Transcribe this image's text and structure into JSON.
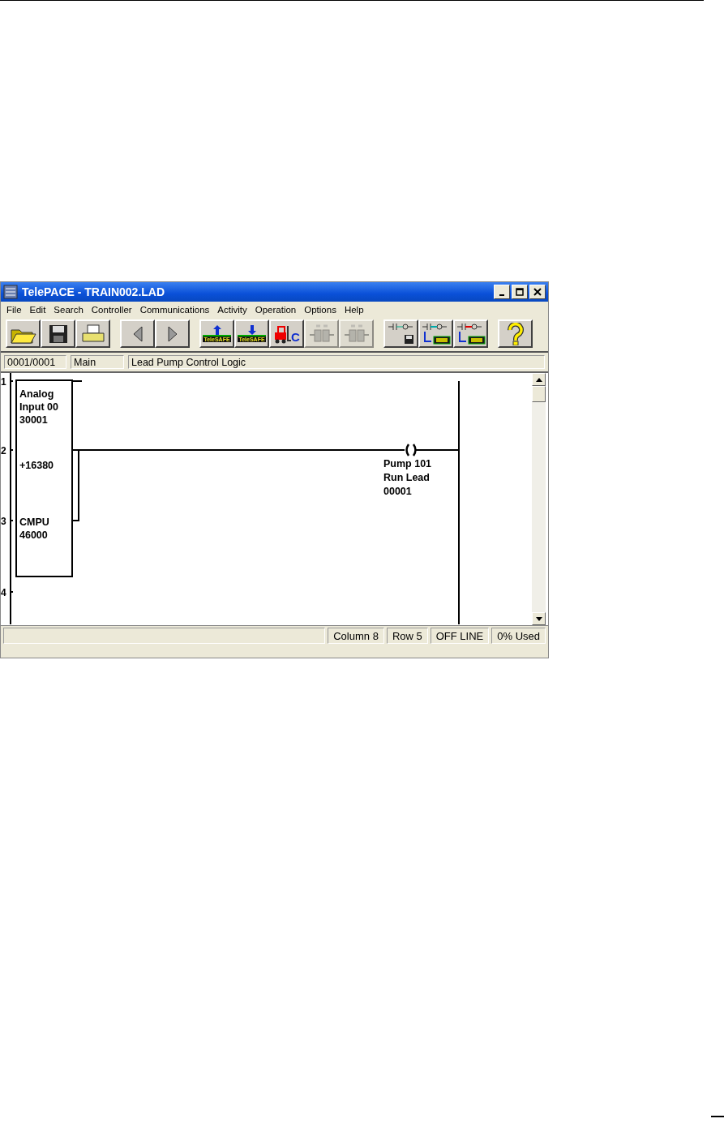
{
  "window": {
    "title": "TelePACE - TRAIN002.LAD"
  },
  "menu": [
    "File",
    "Edit",
    "Search",
    "Controller",
    "Communications",
    "Activity",
    "Operation",
    "Options",
    "Help"
  ],
  "toolbar": [
    [
      {
        "kind": "open",
        "disabled": false
      },
      {
        "kind": "save",
        "disabled": false
      },
      {
        "kind": "print",
        "disabled": false
      }
    ],
    [
      {
        "kind": "back",
        "disabled": false
      },
      {
        "kind": "forward",
        "disabled": false
      }
    ],
    [
      {
        "kind": "upload",
        "label": "TeleSAFE",
        "disabled": false
      },
      {
        "kind": "download",
        "label": "TeleSAFE",
        "disabled": false
      },
      {
        "kind": "forklift",
        "label": "C",
        "disabled": false
      },
      {
        "kind": "connect",
        "disabled": true
      },
      {
        "kind": "disconnect",
        "disabled": true
      }
    ],
    [
      {
        "kind": "ladder-save",
        "disabled": false
      },
      {
        "kind": "ladder-copy",
        "disabled": false
      },
      {
        "kind": "ladder-write",
        "disabled": false
      }
    ],
    [
      {
        "kind": "help",
        "disabled": false
      }
    ]
  ],
  "location_bar": {
    "network": "0001/0001",
    "section": "Main",
    "comment": "Lead Pump Control Logic"
  },
  "ladder": {
    "rung_numbers": [
      "1",
      "2",
      "3",
      "4"
    ],
    "function_block": [
      [
        "Analog",
        "Input 00",
        "30001"
      ],
      [
        "+16380"
      ],
      [
        "CMPU",
        "46000"
      ]
    ],
    "coil": [
      "Pump 101",
      "Run Lead",
      "00001"
    ]
  },
  "status_bar": [
    "Column 8",
    "Row 5",
    "OFF LINE",
    "0% Used"
  ]
}
